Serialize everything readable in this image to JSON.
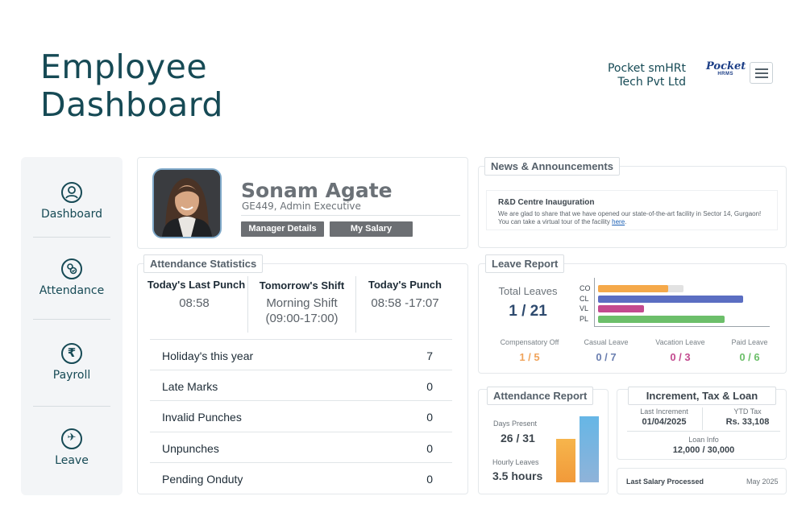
{
  "header": {
    "title_line1": "Employee",
    "title_line2": "Dashboard",
    "company_line1": "Pocket smHRt",
    "company_line2": "Tech Pvt Ltd",
    "logo_line1": "Pocket",
    "logo_line2": "HRMS",
    "menu_icon": "hamburger-icon"
  },
  "sidebar": {
    "items": [
      {
        "label": "Dashboard",
        "icon": "user-circle-icon"
      },
      {
        "label": "Attendance",
        "icon": "attendance-icon"
      },
      {
        "label": "Payroll",
        "icon": "rupee-icon"
      },
      {
        "label": "Leave",
        "icon": "plane-icon"
      }
    ]
  },
  "profile": {
    "name": "Sonam Agate",
    "role": "GE449, Admin Executive",
    "manager_button": "Manager Details",
    "salary_button": "My Salary"
  },
  "attendance_stats": {
    "title": "Attendance Statistics",
    "columns": [
      {
        "header": "Today's Last Punch",
        "value": "08:58"
      },
      {
        "header": "Tomorrow's Shift",
        "value_line1": "Morning Shift",
        "value_line2": "(09:00-17:00)"
      },
      {
        "header": "Today's Punch",
        "value": "08:58 -17:07"
      }
    ],
    "rows": [
      {
        "label": "Holiday's this year",
        "value": "7"
      },
      {
        "label": "Late Marks",
        "value": "0"
      },
      {
        "label": "Invalid Punches",
        "value": "0"
      },
      {
        "label": "Unpunches",
        "value": "0"
      },
      {
        "label": "Pending Onduty",
        "value": "0"
      }
    ]
  },
  "news": {
    "title": "News & Announcements",
    "item_title": "R&D Centre Inauguration",
    "item_body": "We are glad to share that we have opened our state-of-the-art facility in Sector 14, Gurgaon! You can take a virtual tour of the facility",
    "item_link": "here",
    "item_end": "."
  },
  "leave_report": {
    "title": "Leave Report",
    "total_label": "Total Leaves",
    "total_value": "1 / 21",
    "bars": [
      {
        "code": "CO",
        "used_fraction": 0.82,
        "color": "#f5a94a",
        "bg": "#e2e2e2"
      },
      {
        "code": "CL",
        "used_fraction": 1.0,
        "color": "#5b6ec2",
        "bg": "#e2e2e2"
      },
      {
        "code": "VL",
        "used_fraction": 1.0,
        "color": "#c34a8f",
        "bg": "#e2e2e2"
      },
      {
        "code": "PL",
        "used_fraction": 1.0,
        "color": "#6cbf6a",
        "bg": "#e2e2e2"
      }
    ],
    "types": [
      {
        "label": "Compensatory Off",
        "value": "1 / 5",
        "color": "#f0a45c"
      },
      {
        "label": "Casual Leave",
        "value": "0 / 7",
        "color": "#6b7fb0"
      },
      {
        "label": "Vacation Leave",
        "value": "0 / 3",
        "color": "#c34a8f"
      },
      {
        "label": "Paid Leave",
        "value": "0 / 6",
        "color": "#6cbf6a"
      }
    ]
  },
  "attendance_report": {
    "title": "Attendance Report",
    "days_label": "Days Present",
    "days_value": "26 / 31",
    "hourly_label": "Hourly Leaves",
    "hourly_value": "3.5 hours"
  },
  "increment": {
    "title": "Increment, Tax & Loan",
    "last_increment_label": "Last Increment",
    "last_increment_value": "01/04/2025",
    "ytd_label": "YTD Tax",
    "ytd_value": "Rs. 33,108",
    "loan_label": "Loan Info",
    "loan_value": "12,000 / 30,000"
  },
  "salary": {
    "label": "Last Salary Processed",
    "value": "May 2025"
  }
}
